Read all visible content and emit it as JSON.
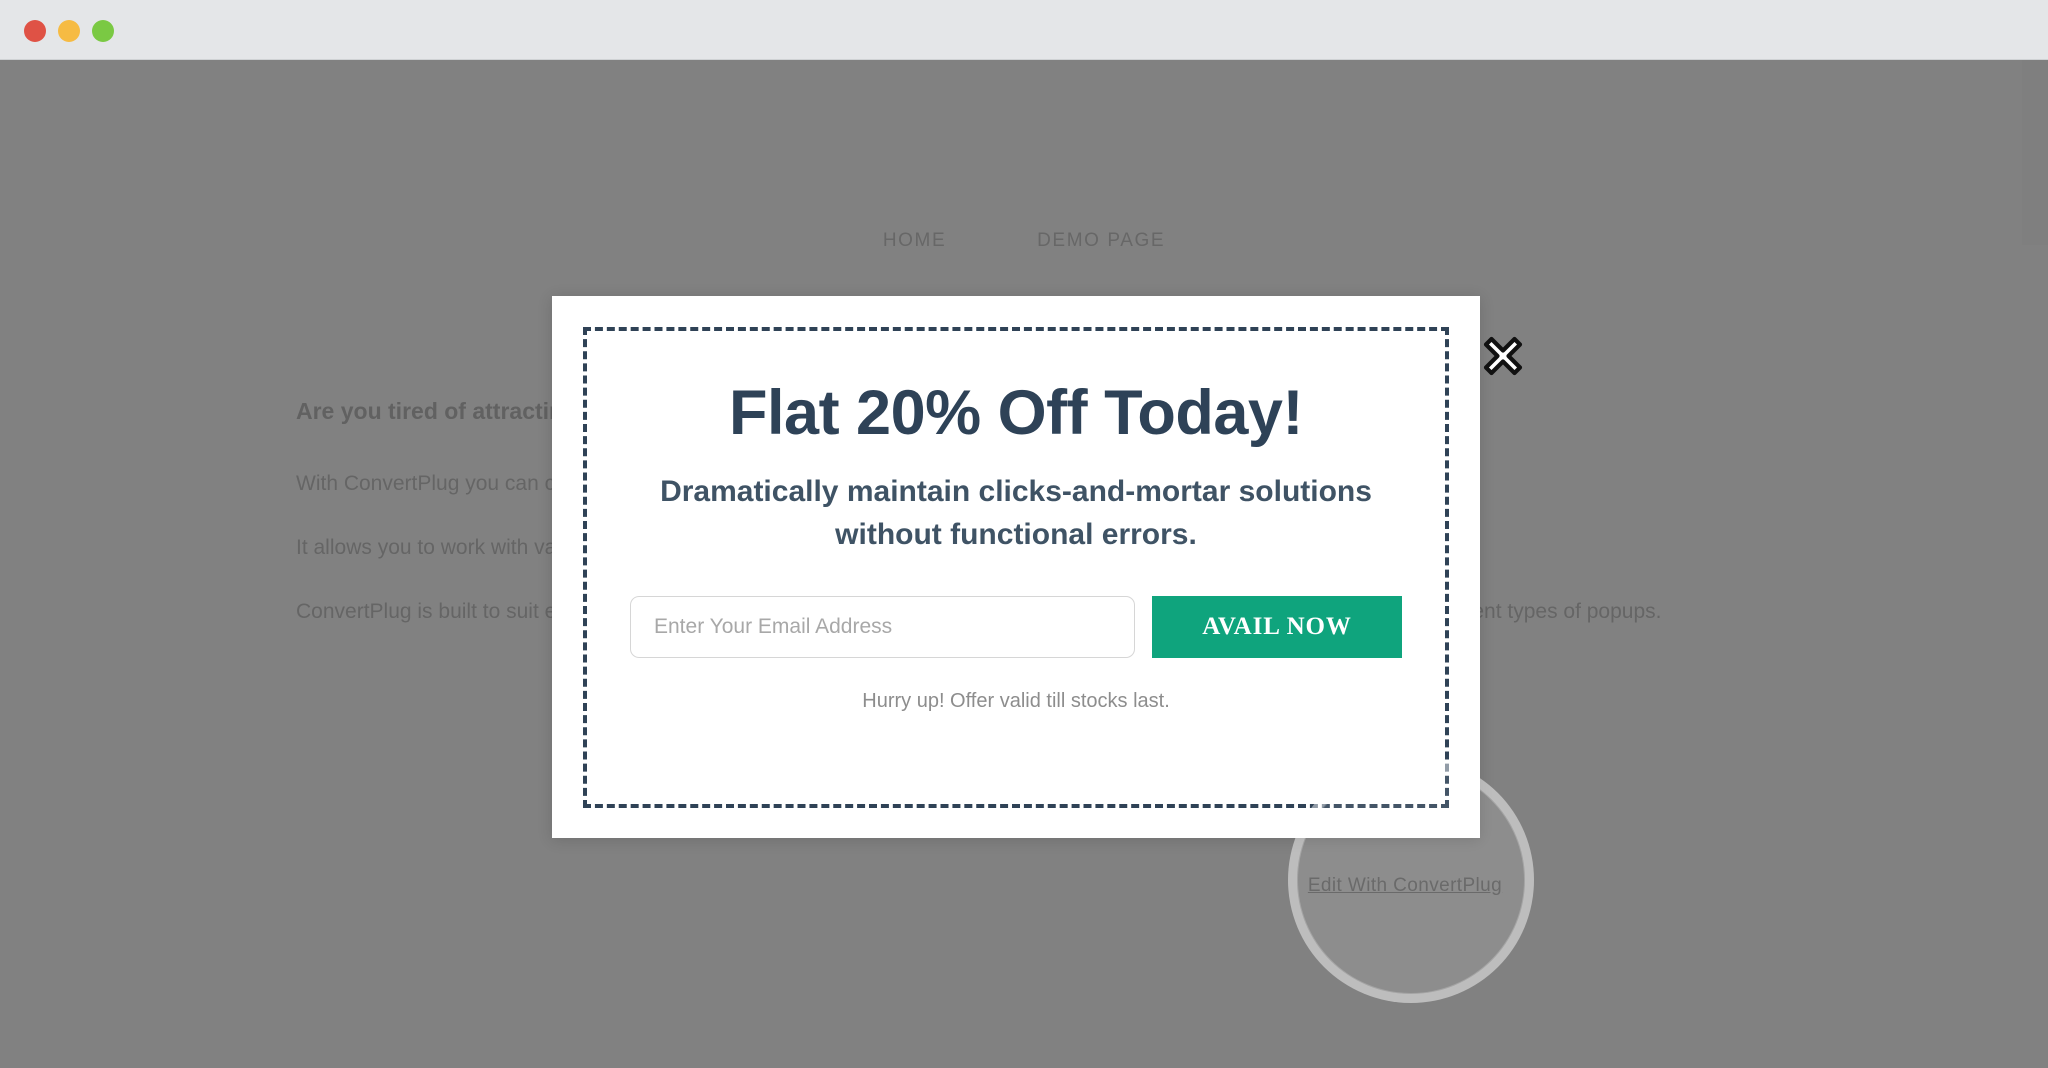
{
  "browser": {
    "traffic_lights": [
      {
        "name": "close",
        "color": "#df5245"
      },
      {
        "name": "minimize",
        "color": "#f6bb43"
      },
      {
        "name": "maximize",
        "color": "#7ac943"
      }
    ]
  },
  "site": {
    "nav": [
      {
        "label": "HOME"
      },
      {
        "label": "DEMO PAGE"
      }
    ],
    "heading": "Are you tired of attracting visitors to your website?",
    "paragraphs": [
      "With ConvertPlug you can create attractive modal popups for your website.",
      "It allows you to work with various popup types and display them at the right time!",
      "ConvertPlug is built to suit every need, be it a business website or a personal blog. You can explore the plugin and create different types of popups."
    ]
  },
  "modal": {
    "title": "Flat 20% Off Today!",
    "subtitle": "Dramatically maintain clicks-and-mortar solutions without functional errors.",
    "email_placeholder": "Enter Your Email Address",
    "email_value": "",
    "submit_label": "AVAIL NOW",
    "footnote": "Hurry up! Offer valid till stocks last.",
    "close_icon": "close-x-icon",
    "border_color": "#2f4256",
    "title_color": "#2e4257",
    "accent_color": "#0fa47d"
  },
  "editor": {
    "edit_link_label": "Edit With ConvertPlug"
  }
}
